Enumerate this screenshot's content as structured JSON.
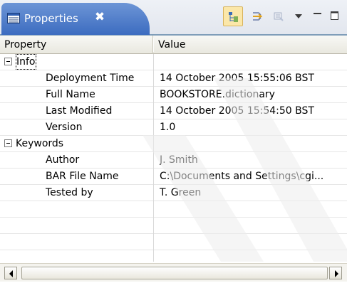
{
  "view": {
    "tab_title": "Properties",
    "tab_close_glyph": "✖",
    "tab_icon": "properties-view-icon",
    "toolbar": {
      "buttons": [
        {
          "icon": "show-categories-icon",
          "pressed": true
        },
        {
          "icon": "show-advanced-properties-icon",
          "pressed": false
        },
        {
          "icon": "restore-default-value-icon",
          "pressed": false
        },
        {
          "icon": "view-menu-icon",
          "pressed": false
        },
        {
          "icon": "minimize-icon",
          "pressed": false
        },
        {
          "icon": "maximize-icon",
          "pressed": false
        }
      ]
    }
  },
  "table": {
    "columns": [
      "Property",
      "Value"
    ],
    "categories": [
      {
        "label": "Info",
        "expanded": true,
        "toggle_glyph": "−",
        "rows": [
          {
            "property": "Deployment Time",
            "value": "14 October 2005 15:55:06 BST"
          },
          {
            "property": "Full Name",
            "value": "BOOKSTORE.dictionary"
          },
          {
            "property": "Last Modified",
            "value": "14 October 2005 15:54:50 BST"
          },
          {
            "property": "Version",
            "value": "1.0"
          }
        ]
      },
      {
        "label": "Keywords",
        "expanded": true,
        "toggle_glyph": "−",
        "rows": [
          {
            "property": "Author",
            "value": "J. Smith"
          },
          {
            "property": "BAR File Name",
            "value": "C:\\Documents and Settings\\cgi..."
          },
          {
            "property": "Tested by",
            "value": "T. Green"
          }
        ]
      }
    ]
  },
  "colors": {
    "tab_active": "#4f7fcf",
    "tab_text": "#ffffff",
    "toolbar_pressed": "#fbe7a9",
    "header_bg": "#efeee6",
    "gridline": "#e6e6e6"
  }
}
